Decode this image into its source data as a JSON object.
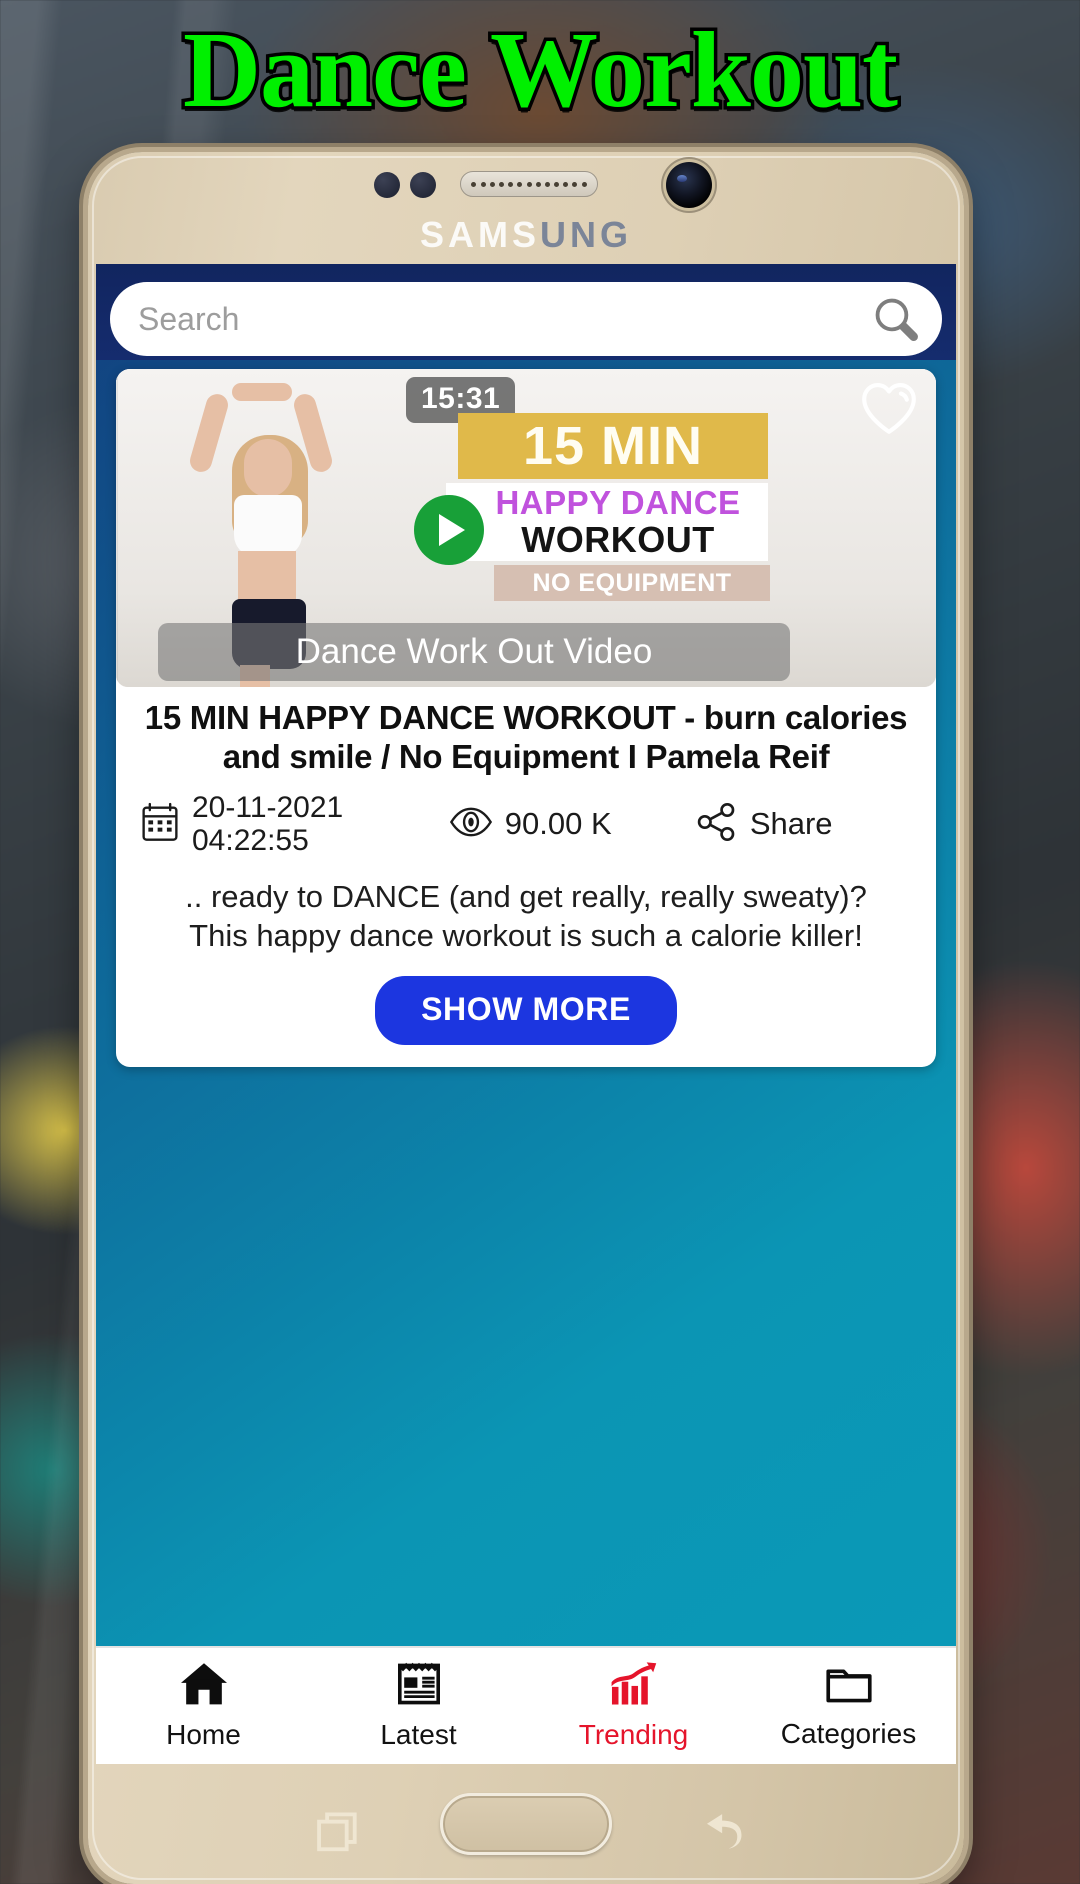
{
  "banner": {
    "title": "Dance Workout",
    "title_color": "#00f000"
  },
  "phone": {
    "brand_light": "SAMS",
    "brand_dark": "UNG",
    "hardware": {
      "recents_icon": "recents-icon",
      "home_button": "home-button",
      "back_icon": "back-icon"
    }
  },
  "app": {
    "header_color": "#11255f",
    "background_gradient_from": "#123f7e",
    "background_gradient_to": "#0a9ab8",
    "search": {
      "placeholder": "Search",
      "value": "",
      "icon": "search-icon"
    },
    "video_card": {
      "thumbnail": {
        "duration": "15:31",
        "favorite_icon": "heart-outline-icon",
        "play_icon": "play-icon",
        "overlay_label": "Dance Work Out Video",
        "poster_text": {
          "minutes": "15 MIN",
          "line1": "HAPPY DANCE",
          "line2": "WORKOUT",
          "line3": "NO EQUIPMENT"
        },
        "colors": {
          "minutes_bg": "#e0b94a",
          "line1_color": "#c052dd",
          "line3_bg": "#d6bfb2",
          "play_bg": "#18a038"
        }
      },
      "title": "15 MIN HAPPY DANCE WORKOUT - burn calories and smile / No Equipment I Pamela Reif",
      "meta": {
        "date_icon": "calendar-icon",
        "date": "20-11-2021",
        "time": "04:22:55",
        "views_icon": "eye-icon",
        "views": "90.00 K",
        "share_icon": "share-icon",
        "share_label": "Share"
      },
      "description_line1": ".. ready to DANCE (and get really, really sweaty)?",
      "description_line2": "This happy dance workout is such a calorie killer!",
      "show_more_label": "SHOW MORE",
      "show_more_color": "#1c36e0"
    },
    "bottom_nav": {
      "active_color": "#e5142b",
      "items": [
        {
          "label": "Home",
          "icon": "home-icon",
          "active": false
        },
        {
          "label": "Latest",
          "icon": "news-icon",
          "active": false
        },
        {
          "label": "Trending",
          "icon": "trending-icon",
          "active": true
        },
        {
          "label": "Categories",
          "icon": "folder-icon",
          "active": false
        }
      ]
    }
  }
}
